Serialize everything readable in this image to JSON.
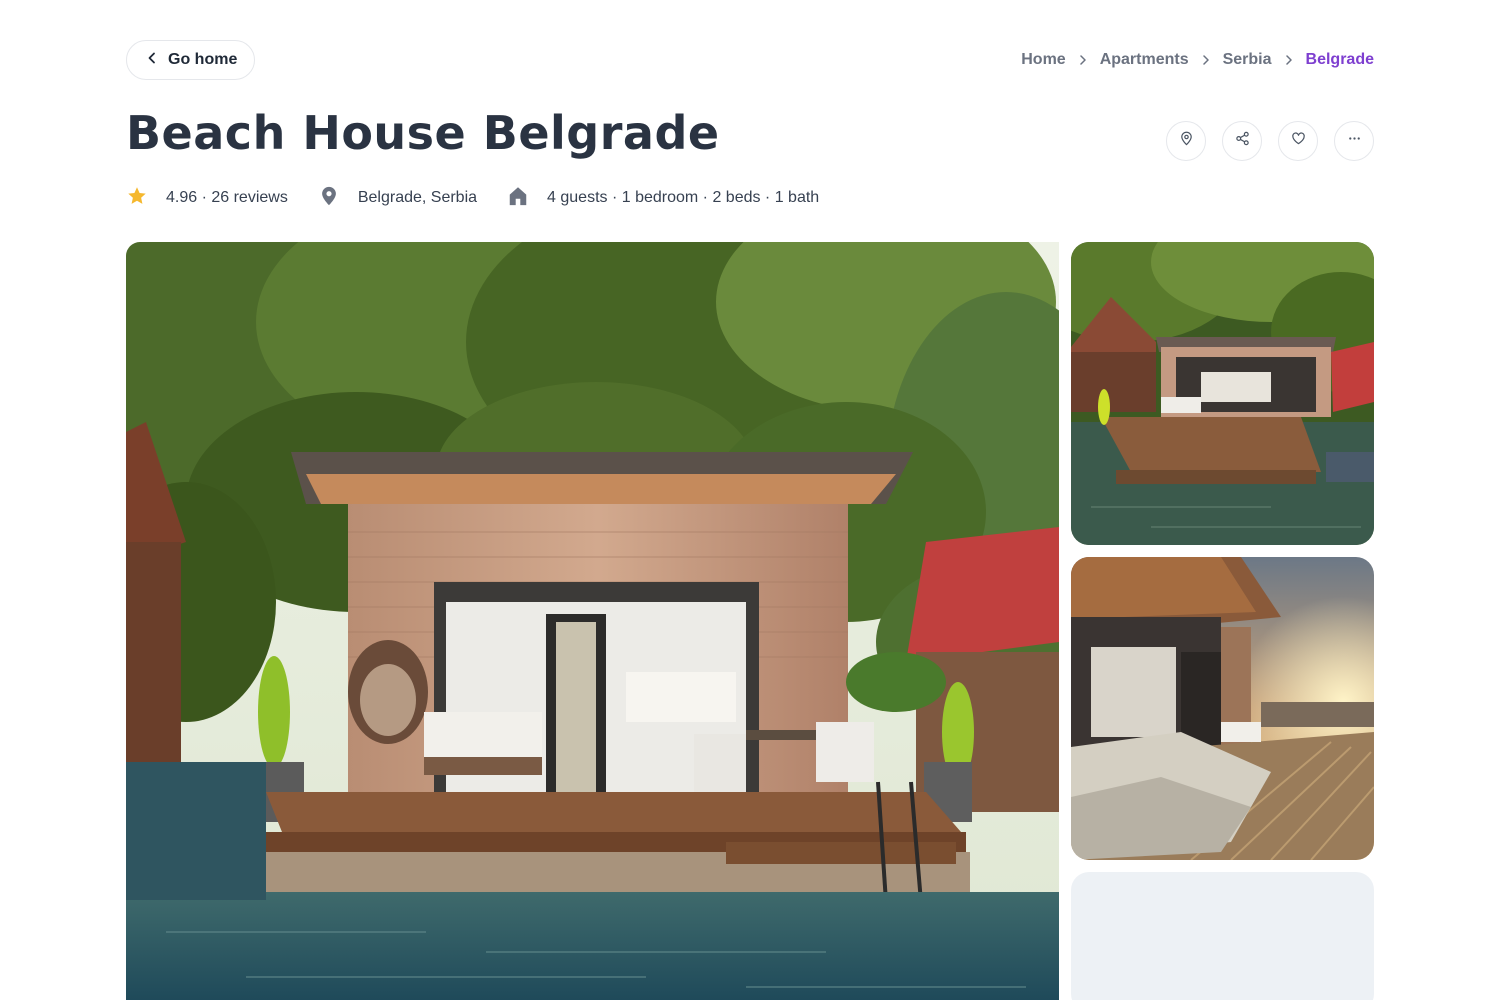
{
  "nav": {
    "go_home_label": "Go home",
    "breadcrumb": [
      "Home",
      "Apartments",
      "Serbia",
      "Belgrade"
    ]
  },
  "listing": {
    "title": "Beach House Belgrade",
    "rating_text": "4.96 · 26 reviews",
    "location_text": "Belgrade, Serbia",
    "details_text": "4 guests · 1 bedroom · 2 beds · 1 bath"
  },
  "actions": [
    {
      "icon": "map-pin-icon"
    },
    {
      "icon": "share-icon"
    },
    {
      "icon": "heart-icon"
    },
    {
      "icon": "more-icon"
    }
  ],
  "colors": {
    "accent": "#7e3fd0",
    "star": "#f5b82e",
    "muted_icon": "#6b7280",
    "title": "#2a3342"
  }
}
